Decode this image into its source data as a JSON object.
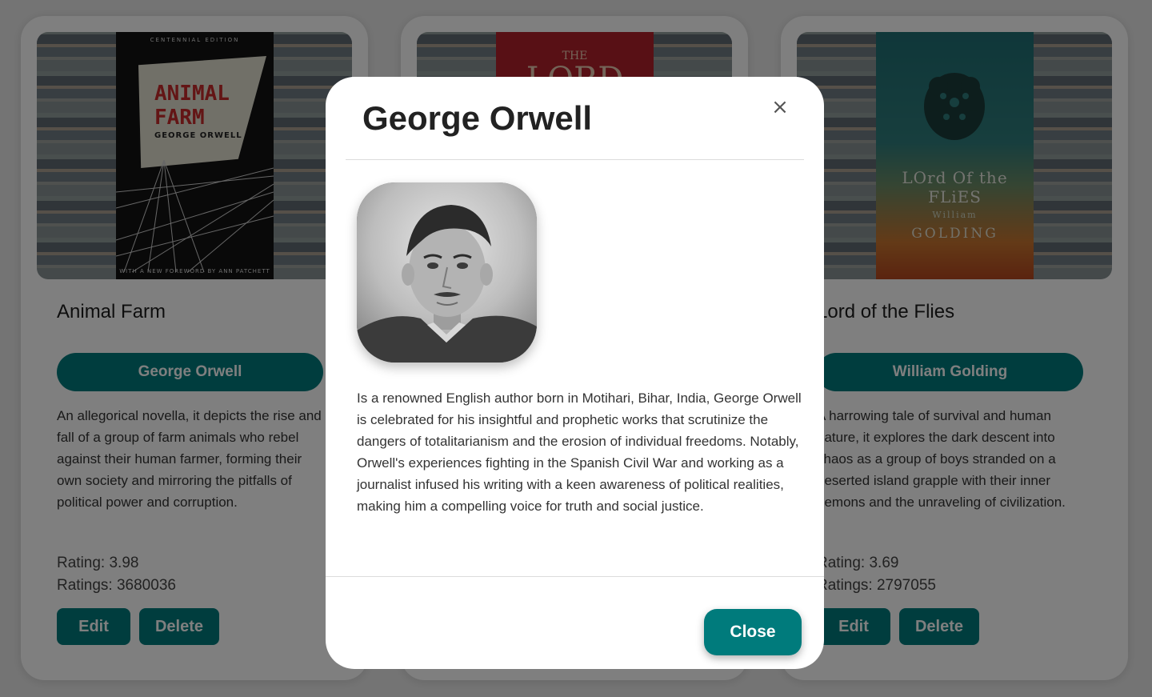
{
  "cards": [
    {
      "title": "Animal Farm",
      "cover": {
        "edition": "CENTENNIAL EDITION",
        "title_line1": "ANIMAL",
        "title_line2": "FARM",
        "author": "GEORGE ORWELL",
        "foreword": "WITH A NEW FOREWORD BY ANN PATCHETT"
      },
      "author_button": "George Orwell",
      "description": "An allegorical novella, it depicts the rise and fall of a group of farm animals who rebel against their human farmer, forming their own society and mirroring the pitfalls of political power and corruption.",
      "rating": "Rating: 3.98",
      "ratings": "Ratings: 3680036",
      "edit_label": "Edit",
      "delete_label": "Delete"
    },
    {
      "cover": {
        "the": "THE",
        "lord": "LORD"
      }
    },
    {
      "title": "Lord of the Flies",
      "cover": {
        "title": "LOrd Of the FLiES",
        "author_first": "William",
        "author_last": "GOLDING"
      },
      "author_button": "William Golding",
      "description": "A harrowing tale of survival and human nature, it explores the dark descent into chaos as a group of boys stranded on a deserted island grapple with their inner demons and the unraveling of civilization.",
      "rating": "Rating: 3.69",
      "ratings": "Ratings: 2797055",
      "edit_label": "Edit",
      "delete_label": "Delete"
    }
  ],
  "modal": {
    "title": "George Orwell",
    "close_x": "×",
    "bio": "Is a renowned English author born in Motihari, Bihar, India, George Orwell is celebrated for his insightful and prophetic works that scrutinize the dangers of totalitarianism and the erosion of individual freedoms. Notably, Orwell's experiences fighting in the Spanish Civil War and working as a journalist infused his writing with a keen awareness of political realities, making him a compelling voice for truth and social justice.",
    "close_button": "Close"
  },
  "colors": {
    "accent": "#007b7c",
    "overlay": "rgba(0,0,0,0.5)"
  }
}
